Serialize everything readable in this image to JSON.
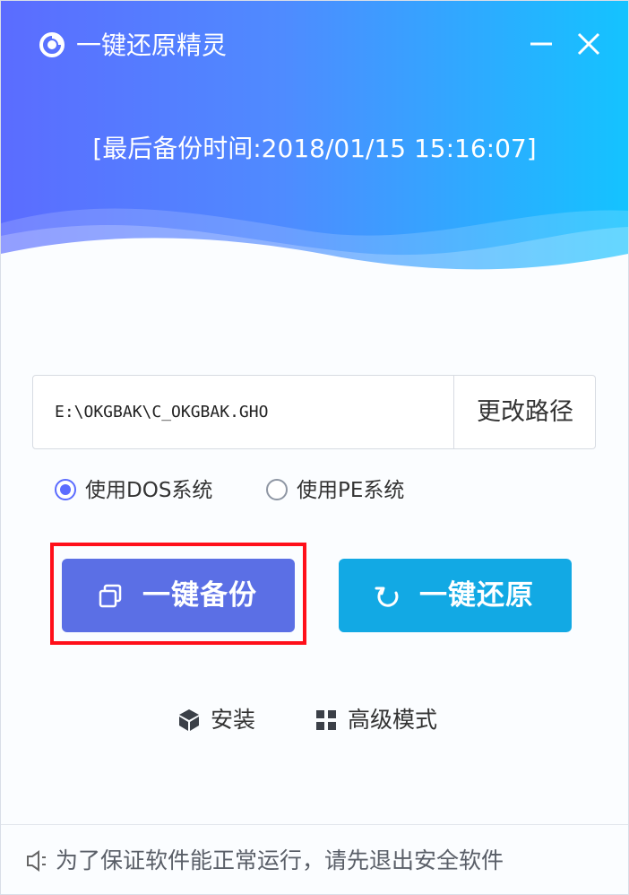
{
  "window": {
    "title": "一键还原精灵",
    "icons": [
      "logo-icon",
      "minimize-icon",
      "close-icon"
    ]
  },
  "header": {
    "backup_time": "[最后备份时间:2018/01/15 15:16:07]"
  },
  "path_box": {
    "value": "E:\\OKGBAK\\C_OKGBAK.GHO",
    "change_label": "更改路径"
  },
  "radios": [
    {
      "label": "使用DOS系统",
      "checked": true
    },
    {
      "label": "使用PE系统",
      "checked": false
    }
  ],
  "actions": {
    "backup_label": "一键备份",
    "restore_label": "一键还原"
  },
  "links": {
    "install_label": "安装",
    "advanced_label": "高级模式"
  },
  "footer": {
    "notice": "为了保证软件能正常运行，请先退出安全软件"
  },
  "colors": {
    "header_start": "#5b6cff",
    "header_end": "#14c3ff",
    "backup_button": "#5b6fe5",
    "restore_button": "#12a9e4",
    "highlight": "#ff0f1a"
  }
}
